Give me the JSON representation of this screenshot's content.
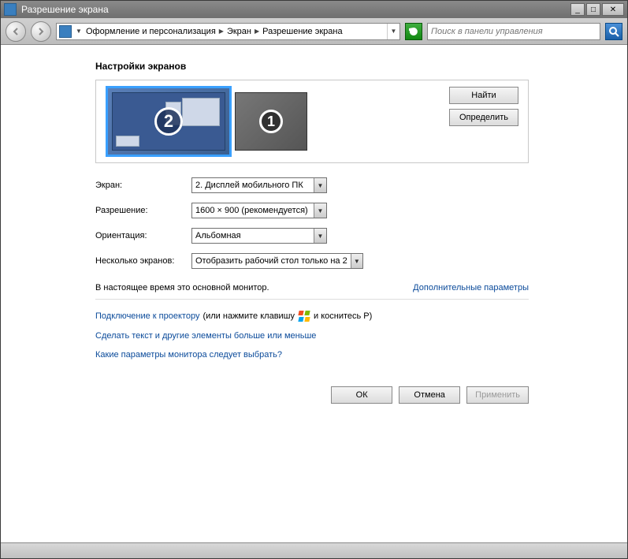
{
  "window": {
    "title": "Разрешение экрана"
  },
  "breadcrumb": {
    "seg1": "Оформление и персонализация",
    "seg2": "Экран",
    "seg3": "Разрешение экрана"
  },
  "search": {
    "placeholder": "Поиск в панели управления"
  },
  "heading": "Настройки экранов",
  "monitors": {
    "num1": "1",
    "num2": "2",
    "find": "Найти",
    "identify": "Определить"
  },
  "form": {
    "display_label": "Экран:",
    "display_value": "2. Дисплей мобильного ПК",
    "resolution_label": "Разрешение:",
    "resolution_value": "1600 × 900 (рекомендуется)",
    "orientation_label": "Ориентация:",
    "orientation_value": "Альбомная",
    "multi_label": "Несколько экранов:",
    "multi_value": "Отобразить рабочий стол только на 2"
  },
  "status": {
    "primary_text": "В настоящее время это основной монитор.",
    "adv_link": "Дополнительные параметры"
  },
  "links": {
    "projector_a": "Подключение к проектору",
    "projector_b": "(или нажмите клавишу",
    "projector_c": "и коснитесь P)",
    "textsize": "Сделать текст и другие элементы больше или меньше",
    "which": "Какие параметры монитора следует выбрать?"
  },
  "buttons": {
    "ok": "ОК",
    "cancel": "Отмена",
    "apply": "Применить"
  }
}
